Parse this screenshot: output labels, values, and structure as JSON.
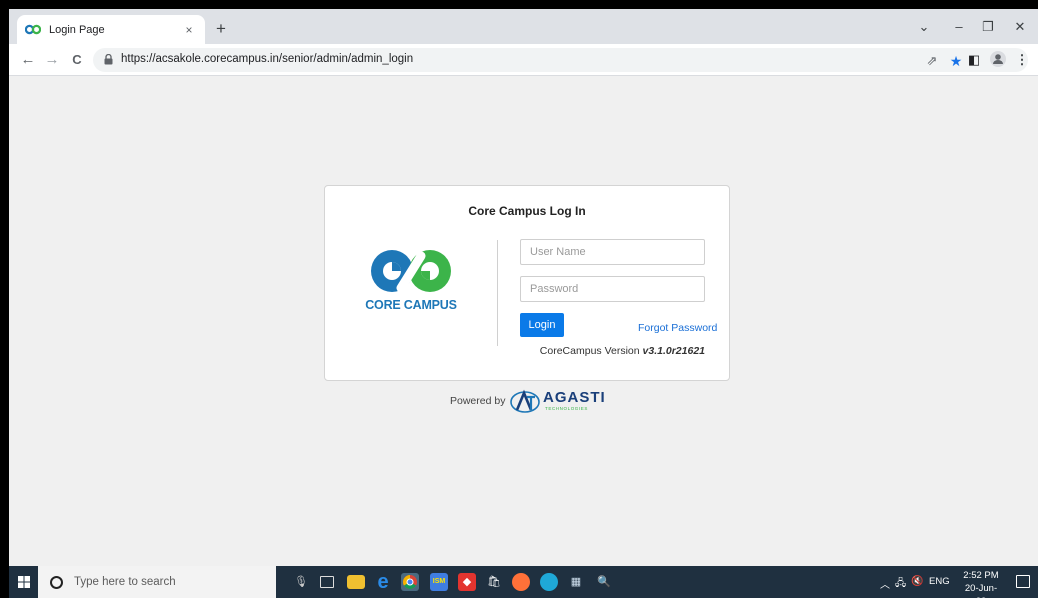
{
  "browser": {
    "tab": {
      "title": "Login Page",
      "close_glyph": "×"
    },
    "new_tab_glyph": "+",
    "window_controls": {
      "dropdown": "⌄",
      "minimize": "–",
      "restore": "❐",
      "close": "✕"
    },
    "nav": {
      "back": "←",
      "forward": "→",
      "reload": "C"
    },
    "url": "https://acsakole.corecampus.in/senior/admin/admin_login",
    "toolbar_icons": {
      "share": "⇗",
      "bookmark_star": "★",
      "side_panel": "◧",
      "menu": "⋮"
    },
    "accent": "#1a73e8"
  },
  "login": {
    "title": "Core Campus Log In",
    "logo_text": "CORE CAMPUS",
    "username_placeholder": "User Name",
    "password_placeholder": "Password",
    "login_label": "Login",
    "forgot_label": "Forgot Password",
    "version_prefix": "CoreCampus Version ",
    "version_number": "v3.1.0r21621",
    "button_color": "#0a7ae8",
    "logo_colors": {
      "blue": "#1e77b7",
      "green": "#3cb44a"
    }
  },
  "footer": {
    "powered_by": "Powered by",
    "brand": "AGASTI",
    "brand_sub": "TECHNOLOGIES"
  },
  "taskbar": {
    "search_placeholder": "Type here to search",
    "lang": "ENG",
    "time": "2:52 PM",
    "date": "20-Jun-23",
    "icons": [
      "windows-logo-icon",
      "search-icon",
      "cortana-mic-icon",
      "task-view-icon",
      "file-explorer-icon",
      "ie-icon",
      "chrome-icon",
      "app-ism-icon",
      "app-anydesk-icon",
      "store-icon",
      "firefox-icon",
      "edge-icon",
      "app-network-icon",
      "app-search-icon"
    ]
  }
}
